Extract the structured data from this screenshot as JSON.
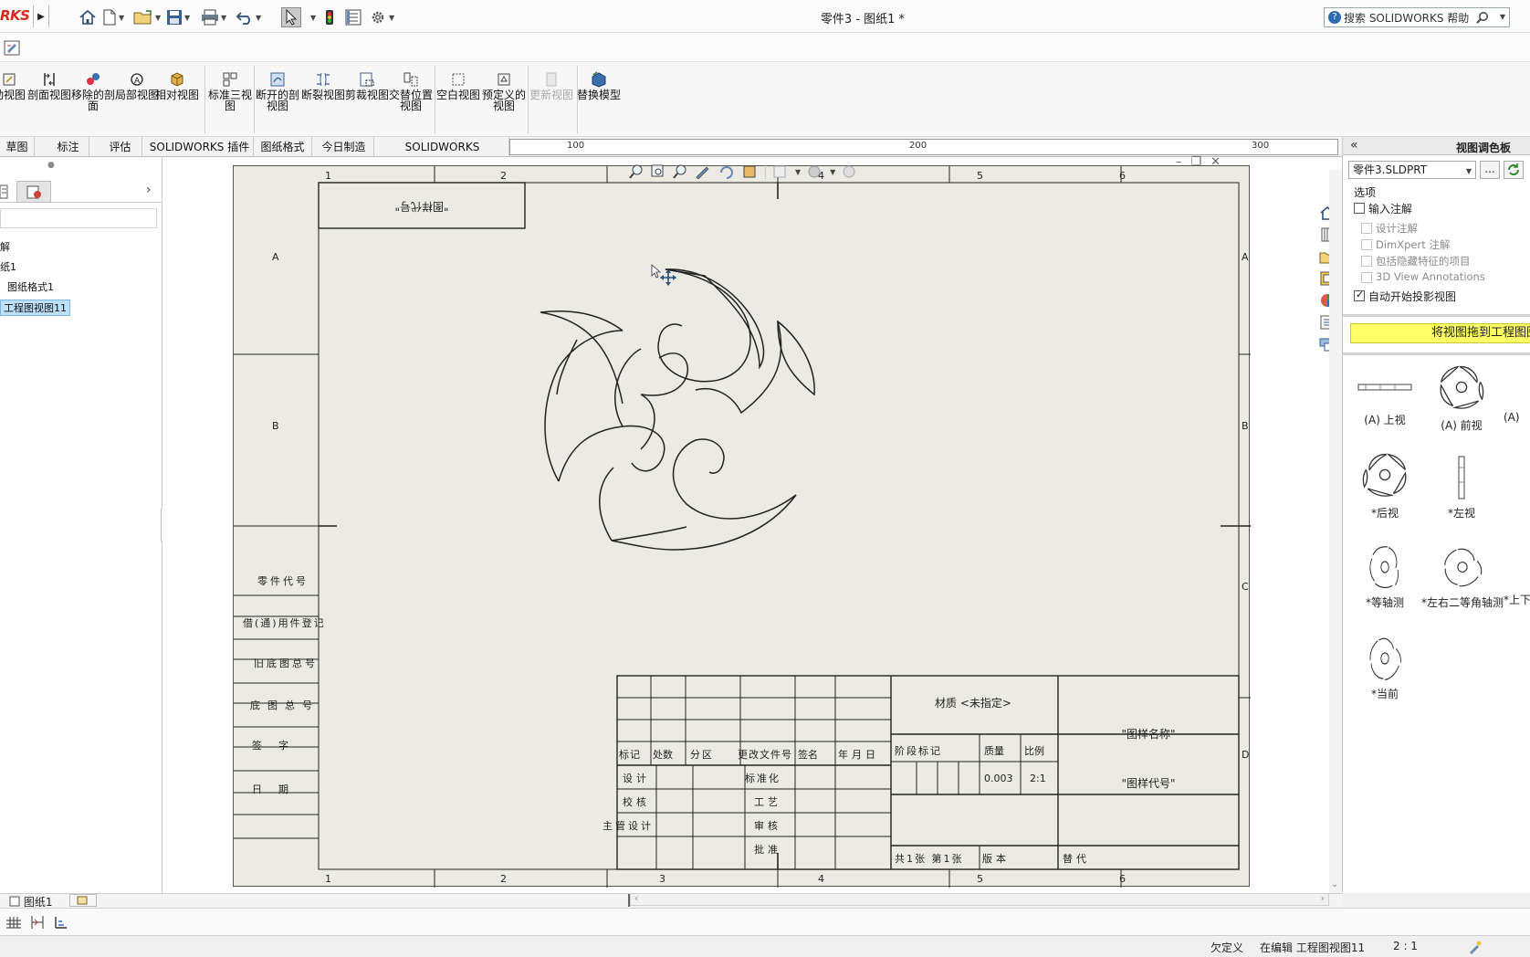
{
  "app": {
    "brand": "RKS",
    "document_title": "零件3 - 图纸1 *"
  },
  "help_search": {
    "placeholder": "搜索 SOLIDWORKS 帮助"
  },
  "ribbon": {
    "buttons": [
      {
        "label": "动视图"
      },
      {
        "label": "剖面视图"
      },
      {
        "label": "移除的剖面"
      },
      {
        "label": "局部视图"
      },
      {
        "label": "相对视图"
      },
      {
        "label": "标准三视图"
      },
      {
        "label": "断开的剖视图"
      },
      {
        "label": "断裂视图"
      },
      {
        "label": "剪裁视图"
      },
      {
        "label": "交替位置视图"
      },
      {
        "label": "空白视图"
      },
      {
        "label": "预定义的视图"
      },
      {
        "label": "更新视图"
      },
      {
        "label": "替换模型"
      }
    ]
  },
  "tabs": [
    "草图",
    "标注",
    "评估",
    "SOLIDWORKS 插件",
    "图纸格式",
    "今日制造",
    "SOLIDWORKS Inspection"
  ],
  "ruler": {
    "labels": [
      "100",
      "200",
      "300"
    ]
  },
  "feature_tree": {
    "items": [
      "解",
      "纸1",
      "图纸格式1",
      "工程图视图11"
    ]
  },
  "sheet": {
    "col_labels": [
      "1",
      "2",
      "3",
      "4",
      "5",
      "6"
    ],
    "row_labels": [
      "A",
      "B",
      "C",
      "D"
    ],
    "top_left_code": "\"图样代号\"",
    "left_block": [
      "零件代号",
      "借(通)用件登记",
      "旧底图总号",
      "底图总号",
      "签字",
      "日期"
    ],
    "title_block": {
      "material": "材质 <未指定>",
      "drawing_name": "\"图样名称\"",
      "drawing_code": "\"图样代号\"",
      "header_row": [
        "标记",
        "处数",
        "分区",
        "更改文件号",
        "签名",
        "年月日"
      ],
      "stage_row": [
        "阶段标记",
        "质量",
        "比例"
      ],
      "mass": "0.003",
      "scale": "2:1",
      "roles": [
        "设计",
        "校核",
        "主管设计",
        "标准化",
        "工艺",
        "审核",
        "批准"
      ],
      "sheet_info": "共1张 第1张",
      "version": "版本",
      "replace": "替代"
    }
  },
  "view_palette": {
    "title": "视图调色板",
    "part": "零件3.SLDPRT",
    "browse": "...",
    "options_title": "选项",
    "import_annotations": "输入注解",
    "design_annotations": "设计注解",
    "dimxpert": "DimXpert 注解",
    "hidden_features": "包括隐藏特征的项目",
    "view_3d": "3D View Annotations",
    "auto_projection": "自动开始投影视图",
    "drag_hint": "将视图拖到工程图图纸",
    "views": [
      "(A) 上视",
      "(A) 前视",
      "*后视",
      "*左视",
      "*等轴测",
      "*左右二等角轴测",
      "*上下",
      "*当前",
      "(A)"
    ]
  },
  "sheet_tab": "图纸1",
  "status": {
    "state": "欠定义",
    "editing": "在编辑 工程图视图11",
    "scale": "2 : 1"
  },
  "colors": {
    "sheet_bg": "#ebebe3",
    "accent_red": "#d52b1e",
    "drag_hint_bg": "#ffff66",
    "selection": "#bde0fb"
  }
}
